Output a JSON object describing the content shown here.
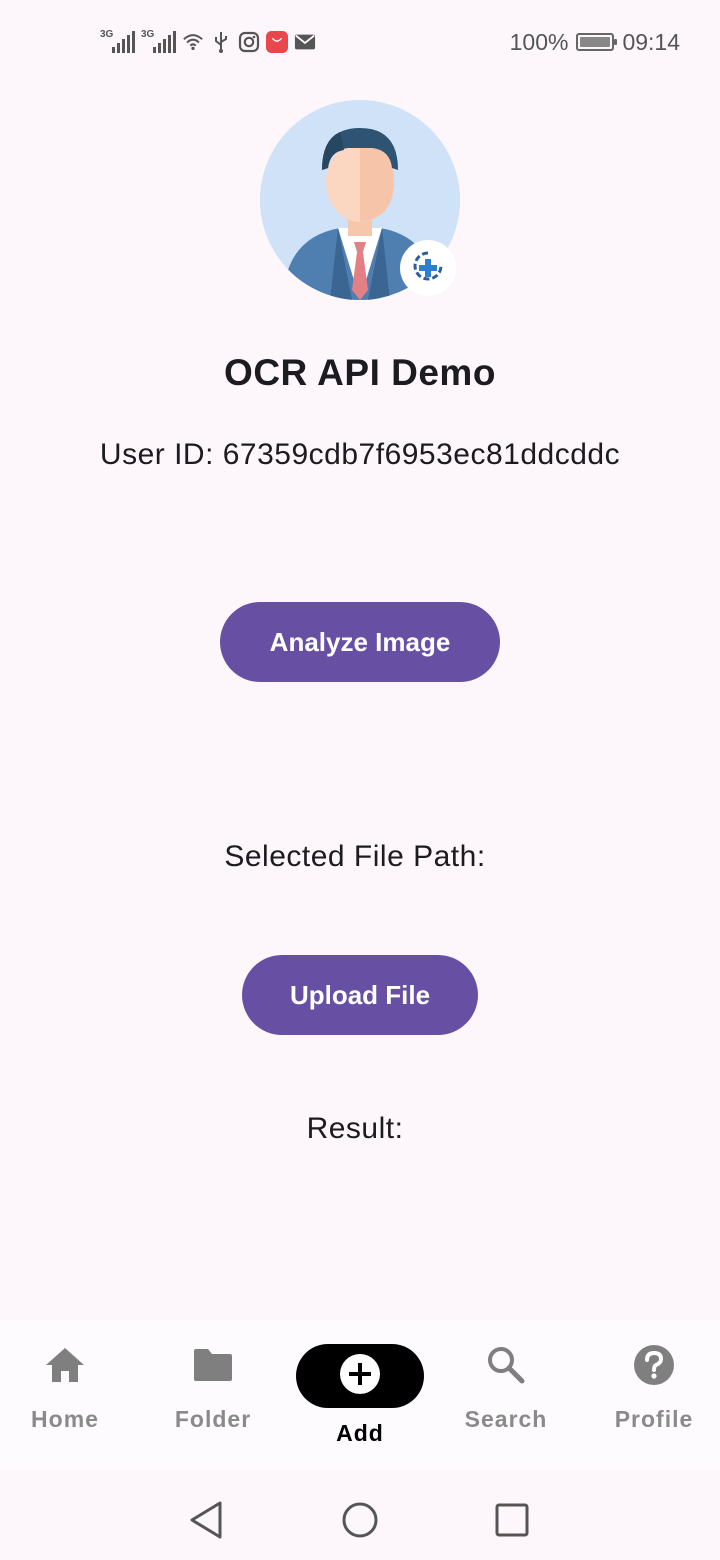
{
  "status_bar": {
    "network_1": "3G",
    "network_2": "3G",
    "battery_percent": "100%",
    "time": "09:14",
    "icons": [
      "signal-icon",
      "signal-icon",
      "wifi-icon",
      "usb-icon",
      "instagram-icon",
      "huawei-appgallery-icon",
      "mail-icon",
      "battery-icon"
    ]
  },
  "header": {
    "title": "OCR API Demo",
    "user_id": "User ID: 67359cdb7f6953ec81ddcddc"
  },
  "actions": {
    "analyze_label": "Analyze Image",
    "upload_label": "Upload File"
  },
  "labels": {
    "file_path": "Selected File Path:",
    "result": "Result:"
  },
  "bottom_nav": {
    "items": [
      {
        "label": "Home",
        "icon": "home-icon"
      },
      {
        "label": "Folder",
        "icon": "folder-icon"
      },
      {
        "label": "Add",
        "icon": "add-circle-icon"
      },
      {
        "label": "Search",
        "icon": "search-icon"
      },
      {
        "label": "Profile",
        "icon": "help-icon"
      }
    ],
    "active_index": 2
  },
  "colors": {
    "background": "#fdf7fc",
    "primary": "#6750a4",
    "nav_inactive": "#8a8a8a",
    "nav_active": "#000000"
  }
}
